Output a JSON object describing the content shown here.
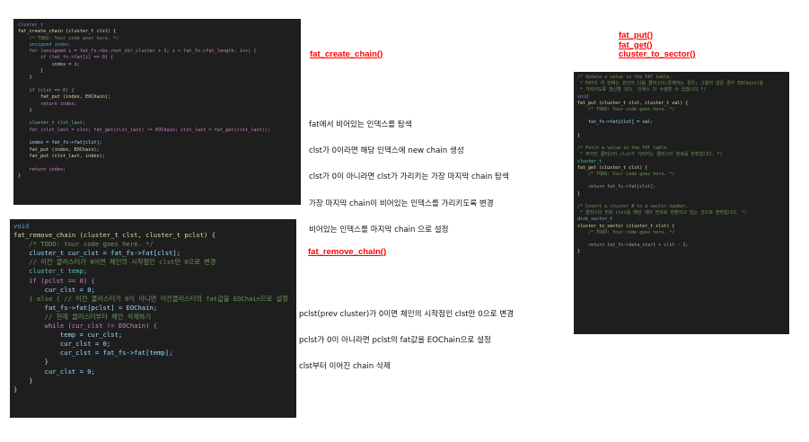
{
  "code_create": {
    "lines": [
      {
        "t": "cluster_t",
        "c": "#569cd6"
      },
      {
        "t": "fat_create_chain (cluster_t clst) {",
        "c": "#dcdcaa"
      },
      {
        "t": "    /* TODO: Your code goes here. */",
        "c": "#6a9955"
      },
      {
        "t": "    unsigned index;",
        "c": "#569cd6"
      },
      {
        "t": "    for (unsigned i = fat_fs->bs.root_dir_cluster + 1; i < fat_fs->fat_length; i++) {",
        "c": "#c586c0"
      },
      {
        "t": "        if (fat_fs->fat[i] == 0) {",
        "c": "#c586c0"
      },
      {
        "t": "            index = i;",
        "c": "#9cdcfe"
      },
      {
        "t": "        }",
        "c": "#d4d4d4"
      },
      {
        "t": "    }",
        "c": "#d4d4d4"
      },
      {
        "t": "",
        "c": "#d4d4d4"
      },
      {
        "t": "    if (clst == 0) {",
        "c": "#c586c0"
      },
      {
        "t": "        fat_put (index, EOChain);",
        "c": "#dcdcaa"
      },
      {
        "t": "        return index;",
        "c": "#c586c0"
      },
      {
        "t": "    }",
        "c": "#d4d4d4"
      },
      {
        "t": "",
        "c": "#d4d4d4"
      },
      {
        "t": "    cluster_t clst_last;",
        "c": "#4ec9b0"
      },
      {
        "t": "    for (clst_last = clst; fat_get(clst_last) != EOChain; clst_last = fat_get(clst_last));",
        "c": "#c586c0"
      },
      {
        "t": "",
        "c": "#d4d4d4"
      },
      {
        "t": "    index = fat_fs->fat[clst];",
        "c": "#9cdcfe"
      },
      {
        "t": "    fat_put (index, EOChain);",
        "c": "#dcdcaa"
      },
      {
        "t": "    fat_put (clst_last, index);",
        "c": "#dcdcaa"
      },
      {
        "t": "",
        "c": "#d4d4d4"
      },
      {
        "t": "    return index;",
        "c": "#c586c0"
      },
      {
        "t": "}",
        "c": "#d4d4d4"
      }
    ]
  },
  "code_remove": {
    "lines": [
      {
        "t": "void",
        "c": "#569cd6"
      },
      {
        "t": "fat_remove_chain (cluster_t clst, cluster_t pclst) {",
        "c": "#dcdcaa"
      },
      {
        "t": "    /* TODO: Your code goes here. */",
        "c": "#6a9955"
      },
      {
        "t": "    cluster_t cur_clst = fat_fs->fat[clst];",
        "c": "#9cdcfe"
      },
      {
        "t": "    // 이전 클러스터가 0이면 체인의 시작점인 clst만 0으로 변경",
        "c": "#6a9955"
      },
      {
        "t": "    cluster_t temp;",
        "c": "#4ec9b0"
      },
      {
        "t": "    if (pclst == 0) {",
        "c": "#c586c0"
      },
      {
        "t": "        cur_clst = 0;",
        "c": "#9cdcfe"
      },
      {
        "t": "    } else { // 이전 클러스터가 0이 아니면 이전클러스터의 fat값을 EOChain으로 설정",
        "c": "#6a9955"
      },
      {
        "t": "        fat_fs->fat[pclst] = EOChain;",
        "c": "#9cdcfe"
      },
      {
        "t": "        // 현재 클러스터부터 체인 삭제하기",
        "c": "#6a9955"
      },
      {
        "t": "        while (cur_clst != EOChain) {",
        "c": "#c586c0"
      },
      {
        "t": "            temp = cur_clst;",
        "c": "#9cdcfe"
      },
      {
        "t": "            cur_clst = 0;",
        "c": "#9cdcfe"
      },
      {
        "t": "            cur_clst = fat_fs->fat[temp];",
        "c": "#9cdcfe"
      },
      {
        "t": "        }",
        "c": "#d4d4d4"
      },
      {
        "t": "        cur_clst = 0;",
        "c": "#9cdcfe"
      },
      {
        "t": "    }",
        "c": "#d4d4d4"
      },
      {
        "t": "}",
        "c": "#d4d4d4"
      }
    ]
  },
  "code_putget": {
    "lines": [
      {
        "t": "/* Update a value in the FAT table.",
        "c": "#6a9955"
      },
      {
        "t": " * FAT의 각 번째는 원인의 다음 클러스터(존재하는 경우; 그렇지 않은 경우 EOChain)을",
        "c": "#6a9955"
      },
      {
        "t": " * 가리키도록 갱신할 있다. 인덱스 더 수월할 수 있습니다 */",
        "c": "#6a9955"
      },
      {
        "t": "void",
        "c": "#569cd6"
      },
      {
        "t": "fat_put (cluster_t clst, cluster_t val) {",
        "c": "#dcdcaa"
      },
      {
        "t": "    /* TODO: Your code goes here. */",
        "c": "#6a9955"
      },
      {
        "t": "",
        "c": "#d4d4d4"
      },
      {
        "t": "    fat_fs->fat[clst] = val;",
        "c": "#9cdcfe"
      },
      {
        "t": "",
        "c": "#d4d4d4"
      },
      {
        "t": "}",
        "c": "#d4d4d4"
      },
      {
        "t": "",
        "c": "#d4d4d4"
      },
      {
        "t": "/* Fetch a value in the FAT table.",
        "c": "#6a9955"
      },
      {
        "t": " * 주어진 클러스터 clst가 가리키는 클러스터 번호를 반환합니다. */",
        "c": "#6a9955"
      },
      {
        "t": "cluster_t",
        "c": "#4ec9b0"
      },
      {
        "t": "fat_get (cluster_t clst) {",
        "c": "#dcdcaa"
      },
      {
        "t": "    /* TODO: Your code goes here. */",
        "c": "#6a9955"
      },
      {
        "t": "",
        "c": "#d4d4d4"
      },
      {
        "t": "    return fat_fs->fat[clst];",
        "c": "#c586c0"
      },
      {
        "t": "}",
        "c": "#d4d4d4"
      },
      {
        "t": "",
        "c": "#d4d4d4"
      },
      {
        "t": "/* Covert a cluster # to a sector number.",
        "c": "#6a9955"
      },
      {
        "t": " * 클러스터 번호 clst를 해당 섹터 번호로 변환하고 있는 것으로 변환합니다. */",
        "c": "#6a9955"
      },
      {
        "t": "disk_sector_t",
        "c": "#4ec9b0"
      },
      {
        "t": "cluster_to_sector (cluster_t clst) {",
        "c": "#dcdcaa"
      },
      {
        "t": "    /* TODO: Your code goes here. */",
        "c": "#6a9955"
      },
      {
        "t": "",
        "c": "#d4d4d4"
      },
      {
        "t": "    return fat_fs->data_start + clst - 1;",
        "c": "#c586c0"
      },
      {
        "t": "}",
        "c": "#d4d4d4"
      }
    ]
  },
  "headings": {
    "create": "fat_create_chain()",
    "remove": "fat_remove_chain()",
    "put": "fat_put()",
    "get": "fat_get()",
    "to_sector": "cluster_to_sector()"
  },
  "notes_create": [
    "fat에서 비어있는 인덱스를 탐색",
    "clst가 0이라면 해당 인덱스에 new chain 생성",
    "clst가 0이 아니라면 clst가 가리키는 가장 마지막 chain 탐색",
    "가장 마지막 chain이 비어있는 인덱스를 가리키도록 변경",
    "비어있는 인덱스를 마지막 chain 으로 설정"
  ],
  "notes_remove": [
    "pclst(prev cluster)가 0이면 체인의 시작점인 clst만 0으로 변경",
    "pclst가 0이 아니라면 pclst의 fat값을 EOChain으로 설정",
    "clst부터 이어진 chain 삭제"
  ]
}
